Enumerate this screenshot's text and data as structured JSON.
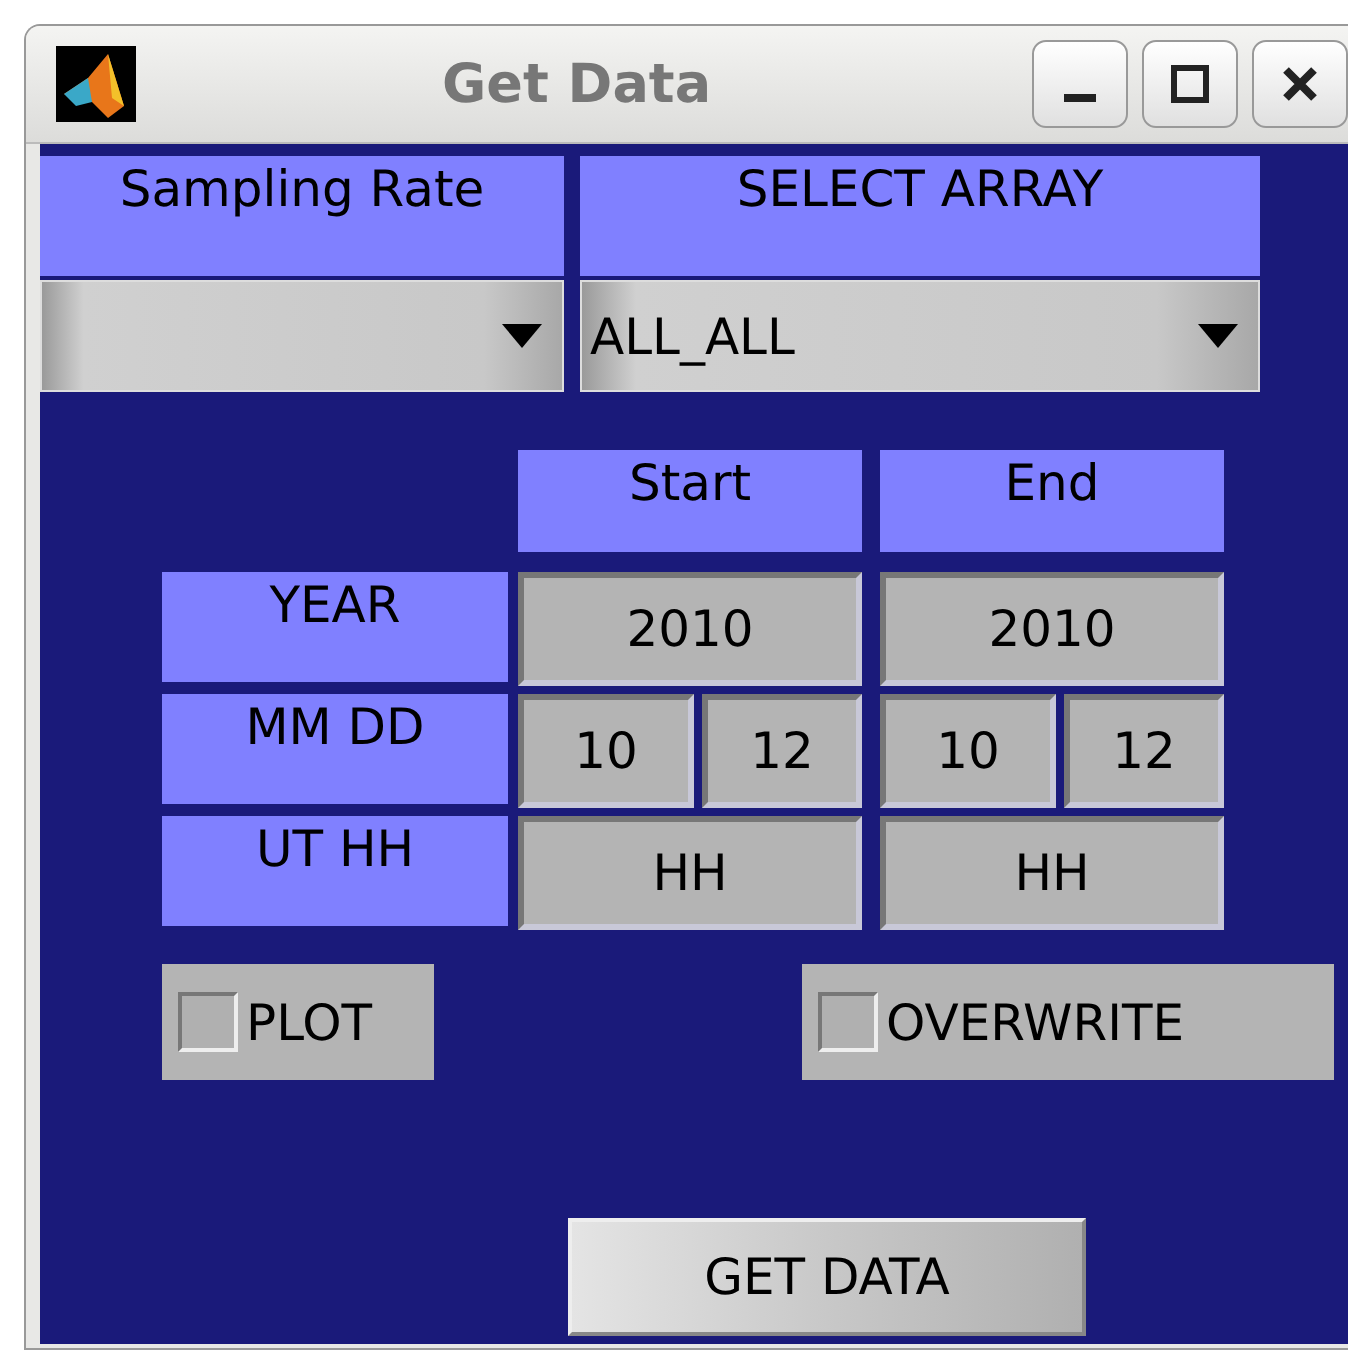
{
  "window": {
    "title": "Get Data"
  },
  "selectors": [
    {
      "label": "Sampling Rate"
    },
    {
      "label": "SELECT ARRAY",
      "value": "ALL_ALL"
    }
  ],
  "columns": [
    "Start",
    "End"
  ],
  "rows": [
    {
      "label": "YEAR",
      "start": [
        "2010"
      ],
      "end": [
        "2010"
      ]
    },
    {
      "label": "MM DD",
      "start": [
        "10",
        "12"
      ],
      "end": [
        "10",
        "12"
      ]
    },
    {
      "label": "UT HH",
      "start": [
        "HH"
      ],
      "end": [
        "HH"
      ]
    }
  ],
  "checkboxes": [
    {
      "label": "PLOT",
      "checked": false
    },
    {
      "label": "OVERWRITE",
      "checked": false
    }
  ],
  "button": "GET DATA"
}
